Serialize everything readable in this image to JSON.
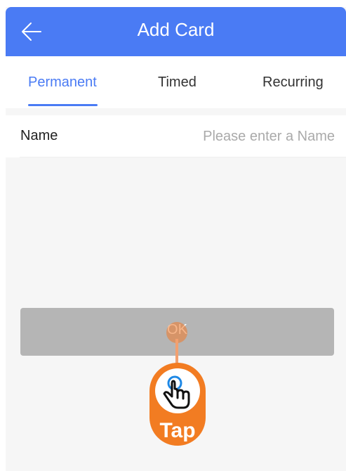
{
  "header": {
    "title": "Add Card",
    "back_icon": "arrow-left-icon"
  },
  "tabs": [
    {
      "label": "Permanent",
      "active": true
    },
    {
      "label": "Timed",
      "active": false
    },
    {
      "label": "Recurring",
      "active": false
    }
  ],
  "form": {
    "name_label": "Name",
    "name_value": "",
    "name_placeholder": "Please enter a Name"
  },
  "ok_button": {
    "label": "OK"
  },
  "tap_hint": {
    "label": "Tap",
    "icon": "pointing-hand-icon"
  },
  "colors": {
    "accent": "#4a7bf4",
    "button_disabled": "#b5b5b5",
    "hint": "#f27c22"
  }
}
